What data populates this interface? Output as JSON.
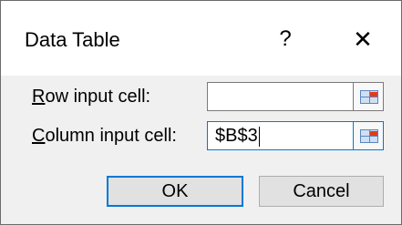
{
  "dialog": {
    "title": "Data Table",
    "help_label": "?",
    "close_label": "✕"
  },
  "row_input": {
    "label_hotkey": "R",
    "label_rest": "ow input cell:",
    "value": ""
  },
  "column_input": {
    "label_hotkey": "C",
    "label_rest": "olumn input cell:",
    "value": "$B$3"
  },
  "buttons": {
    "ok_label": "OK",
    "cancel_label": "Cancel"
  },
  "icons": {
    "ref_button_icon": "range-select-icon"
  }
}
